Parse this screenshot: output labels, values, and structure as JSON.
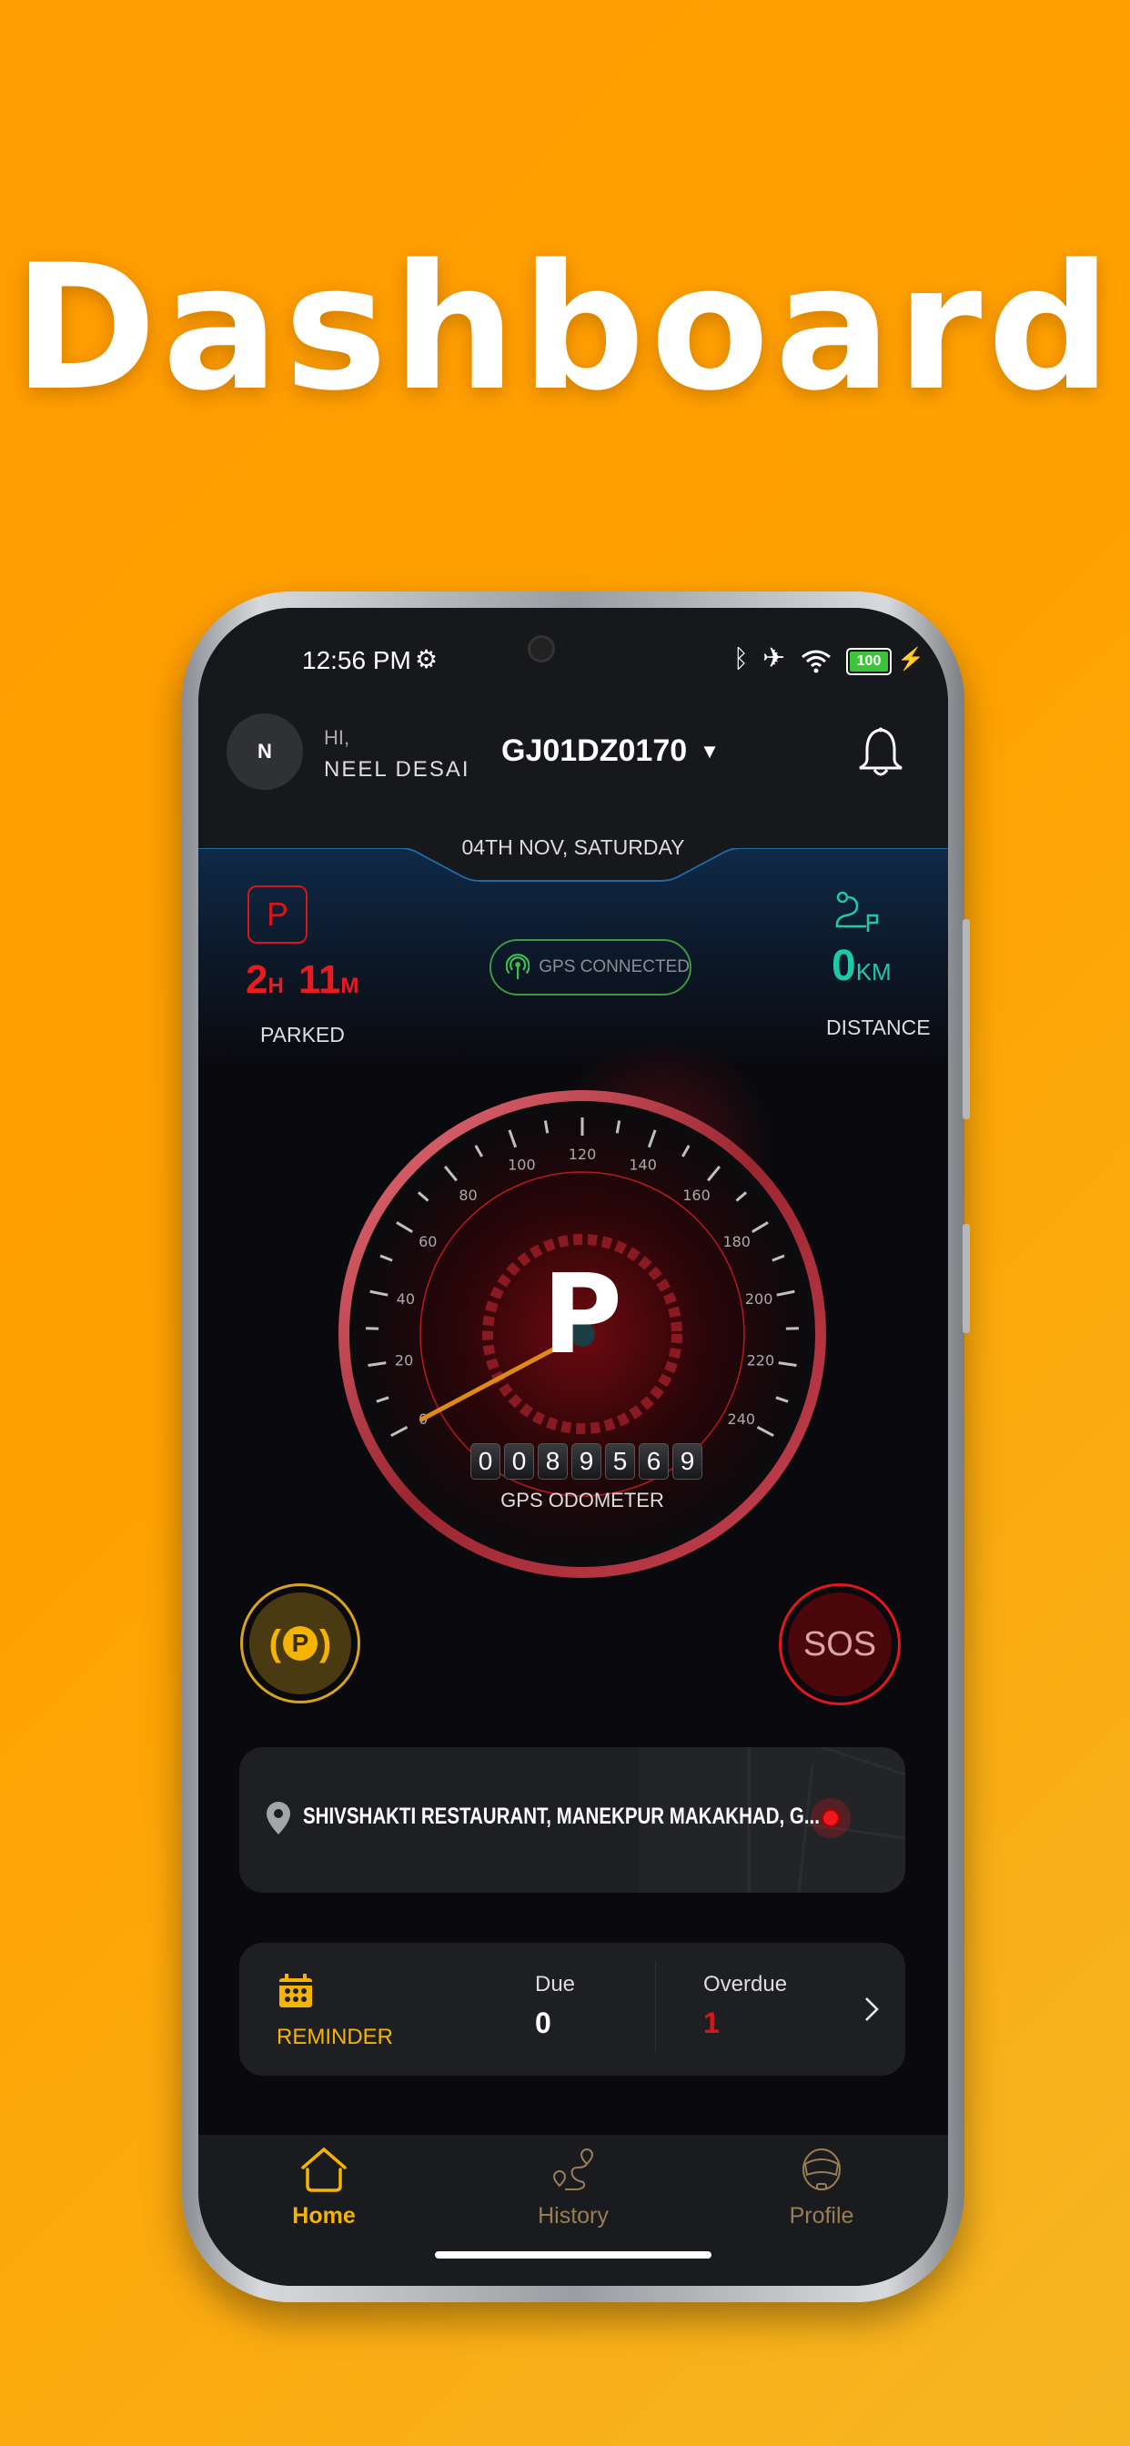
{
  "title": "Dashboard",
  "status_bar": {
    "time": "12:56 PM",
    "battery": "100",
    "icons": [
      "gear-icon",
      "bluetooth-icon",
      "airplane-icon",
      "wifi-icon",
      "battery-icon",
      "charging-icon"
    ]
  },
  "header": {
    "avatar_initial": "N",
    "greeting": "HI,",
    "user_name": "NEEL DESAI",
    "vehicle_plate": "GJ01DZ0170",
    "date": "04TH NOV, SATURDAY"
  },
  "parked": {
    "hours": "2",
    "hours_unit": "H",
    "minutes": "11",
    "minutes_unit": "M",
    "label": "PARKED",
    "icon_letter": "P"
  },
  "gps": {
    "label": "GPS CONNECTED"
  },
  "distance": {
    "value": "0",
    "unit": "KM",
    "label": "DISTANCE"
  },
  "gauge": {
    "labels": [
      "0",
      "20",
      "40",
      "60",
      "80",
      "100",
      "120",
      "140",
      "160",
      "180",
      "200",
      "220",
      "240"
    ],
    "min": 0,
    "max": 240,
    "speed": 0,
    "gear": "P",
    "odometer_digits": [
      "0",
      "0",
      "8",
      "9",
      "5",
      "6",
      "9"
    ],
    "odometer_label": "GPS ODOMETER"
  },
  "buttons": {
    "parking_letter": "P",
    "sos": "SOS"
  },
  "location": {
    "address": "SHIVSHAKTI RESTAURANT, MANEKPUR MAKAKHAD, G..."
  },
  "reminder": {
    "label": "REMINDER",
    "due_label": "Due",
    "due_value": "0",
    "overdue_label": "Overdue",
    "overdue_value": "1"
  },
  "nav": {
    "items": [
      {
        "label": "Home",
        "active": true
      },
      {
        "label": "History",
        "active": false
      },
      {
        "label": "Profile",
        "active": false
      }
    ]
  },
  "colors": {
    "accent": "#f5b400",
    "danger": "#e3161b",
    "teal": "#1ec9a8",
    "gps_green": "#3fbf52"
  }
}
